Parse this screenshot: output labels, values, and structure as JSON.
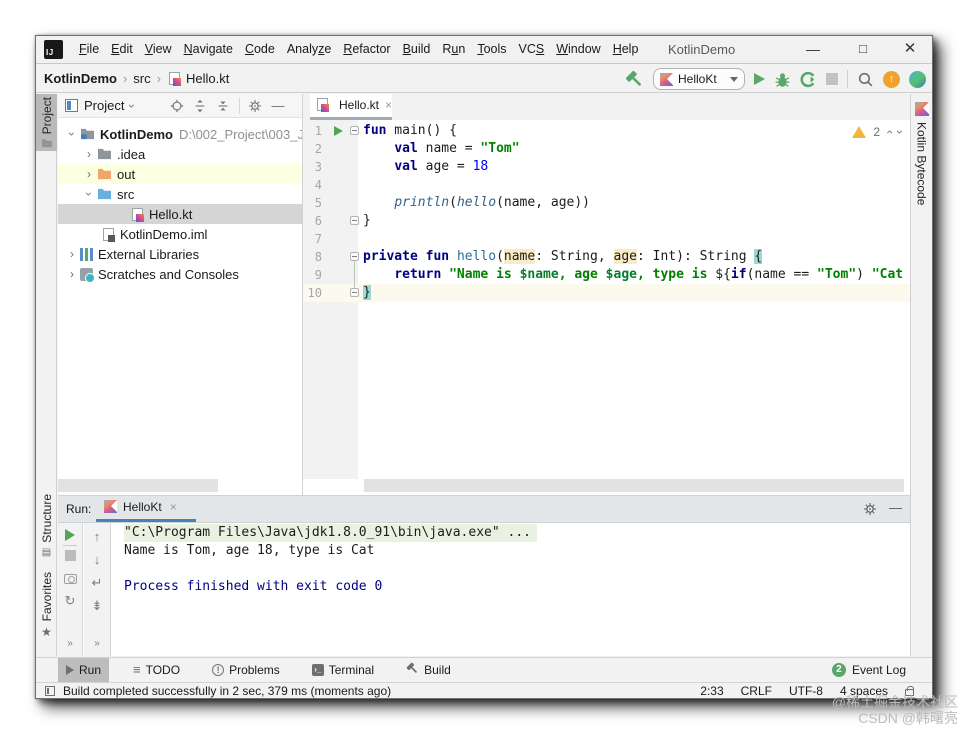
{
  "window": {
    "title": "KotlinDemo",
    "logo": "IJ"
  },
  "menu": {
    "items": [
      {
        "label": "File",
        "u": 0
      },
      {
        "label": "Edit",
        "u": 0
      },
      {
        "label": "View",
        "u": 0
      },
      {
        "label": "Navigate",
        "u": 0
      },
      {
        "label": "Code",
        "u": 0
      },
      {
        "label": "Analyze",
        "u": 5
      },
      {
        "label": "Refactor",
        "u": 0
      },
      {
        "label": "Build",
        "u": 0
      },
      {
        "label": "Run",
        "u": 1
      },
      {
        "label": "Tools",
        "u": 0
      },
      {
        "label": "VCS",
        "u": 2
      },
      {
        "label": "Window",
        "u": 0
      },
      {
        "label": "Help",
        "u": 0
      }
    ]
  },
  "toolbar": {
    "breadcrumb": [
      {
        "label": "KotlinDemo",
        "bold": true,
        "icon": null
      },
      {
        "label": "src",
        "bold": false,
        "icon": null
      },
      {
        "label": "Hello.kt",
        "bold": false,
        "icon": "kotlin-file"
      }
    ],
    "run_config": "HelloKt"
  },
  "left_stripe": {
    "top": "Project",
    "bottom": [
      "Structure",
      "Favorites"
    ]
  },
  "right_stripe": {
    "label": "Kotlin Bytecode"
  },
  "project": {
    "title": "Project",
    "tree": [
      {
        "label": "KotlinDemo",
        "path": "D:\\002_Project\\003_J",
        "icon": "folder-project",
        "chevron": "open",
        "pad": 6,
        "bold": true
      },
      {
        "label": ".idea",
        "icon": "folder-gray",
        "chevron": "closed",
        "pad": 23
      },
      {
        "label": "out",
        "icon": "folder-orange",
        "chevron": "closed",
        "pad": 23,
        "highlight": true
      },
      {
        "label": "src",
        "icon": "folder-blue",
        "chevron": "open",
        "pad": 23
      },
      {
        "label": "Hello.kt",
        "icon": "kotlin-file",
        "chevron": "none",
        "pad": 56,
        "selected": true
      },
      {
        "label": "KotlinDemo.iml",
        "icon": "iml-file",
        "chevron": "none",
        "pad": 27
      },
      {
        "label": "External Libraries",
        "icon": "libraries",
        "chevron": "closed",
        "pad": 6
      },
      {
        "label": "Scratches and Consoles",
        "icon": "scratches",
        "chevron": "closed",
        "pad": 6
      }
    ]
  },
  "editor": {
    "tab": "Hello.kt",
    "warning_count": "2",
    "lines": [
      {
        "num": "1",
        "segs": [
          [
            "fun",
            "k"
          ],
          [
            " main() {",
            "t"
          ]
        ]
      },
      {
        "num": "2",
        "segs": [
          [
            "    ",
            "t"
          ],
          [
            "val",
            "k"
          ],
          [
            " name = ",
            "t"
          ],
          [
            "\"Tom\"",
            "s"
          ]
        ]
      },
      {
        "num": "3",
        "segs": [
          [
            "    ",
            "t"
          ],
          [
            "val",
            "k"
          ],
          [
            " age = ",
            "t"
          ],
          [
            "18",
            "n"
          ]
        ]
      },
      {
        "num": "4",
        "segs": []
      },
      {
        "num": "5",
        "segs": [
          [
            "    ",
            "t"
          ],
          [
            "println",
            "f"
          ],
          [
            "(",
            "t"
          ],
          [
            "hello",
            "f"
          ],
          [
            "(name, age))",
            "t"
          ]
        ]
      },
      {
        "num": "6",
        "segs": [
          [
            "}",
            "t"
          ]
        ]
      },
      {
        "num": "7",
        "segs": []
      },
      {
        "num": "8",
        "segs": [
          [
            "private",
            "k"
          ],
          [
            " ",
            "t"
          ],
          [
            "fun",
            "k"
          ],
          [
            " ",
            "t"
          ],
          [
            "hello",
            "d"
          ],
          [
            "(",
            "t"
          ],
          [
            "name",
            "p"
          ],
          [
            ": String, ",
            "t"
          ],
          [
            "age",
            "p"
          ],
          [
            ": Int): String ",
            "t"
          ],
          [
            "{",
            "b"
          ]
        ]
      },
      {
        "num": "9",
        "segs": [
          [
            "    ",
            "t"
          ],
          [
            "return",
            "k"
          ],
          [
            " ",
            "t"
          ],
          [
            "\"Name is ",
            "s"
          ],
          [
            "$name",
            "v"
          ],
          [
            ", age ",
            "s"
          ],
          [
            "$age",
            "v"
          ],
          [
            ", type is ",
            "s"
          ],
          [
            "${",
            "t"
          ],
          [
            "if",
            "k"
          ],
          [
            "(name == ",
            "t"
          ],
          [
            "\"Tom\"",
            "s"
          ],
          [
            ") ",
            "t"
          ],
          [
            "\"Cat",
            "s"
          ]
        ]
      },
      {
        "num": "10",
        "segs": [
          [
            "}",
            "b"
          ]
        ]
      }
    ],
    "fold_lines": [
      1,
      6,
      8,
      10
    ],
    "run_line": 1,
    "current_line": 10
  },
  "run_panel": {
    "label": "Run:",
    "tab": "HelloKt",
    "console": [
      {
        "text": "\"C:\\Program Files\\Java\\jdk1.8.0_91\\bin\\java.exe\" ...",
        "style": "grn"
      },
      {
        "text": "Name is Tom, age 18, type is Cat",
        "style": ""
      },
      {
        "text": "",
        "style": ""
      },
      {
        "text": "Process finished with exit code 0",
        "style": "sys"
      }
    ]
  },
  "bottom_bar": {
    "items": [
      {
        "label": "Run",
        "icon": "play",
        "active": true
      },
      {
        "label": "TODO",
        "icon": "todo",
        "active": false
      },
      {
        "label": "Problems",
        "icon": "problems",
        "active": false
      },
      {
        "label": "Terminal",
        "icon": "terminal",
        "active": false
      },
      {
        "label": "Build",
        "icon": "hammer",
        "active": false
      }
    ],
    "event_log": {
      "count": "2",
      "label": "Event Log"
    }
  },
  "status_bar": {
    "message": "Build completed successfully in 2 sec, 379 ms (moments ago)",
    "items": [
      "2:33",
      "CRLF",
      "UTF-8",
      "4 spaces"
    ]
  },
  "watermark": {
    "line1": "@稀土掘金技术社区",
    "line2": "CSDN @韩曙亮"
  }
}
